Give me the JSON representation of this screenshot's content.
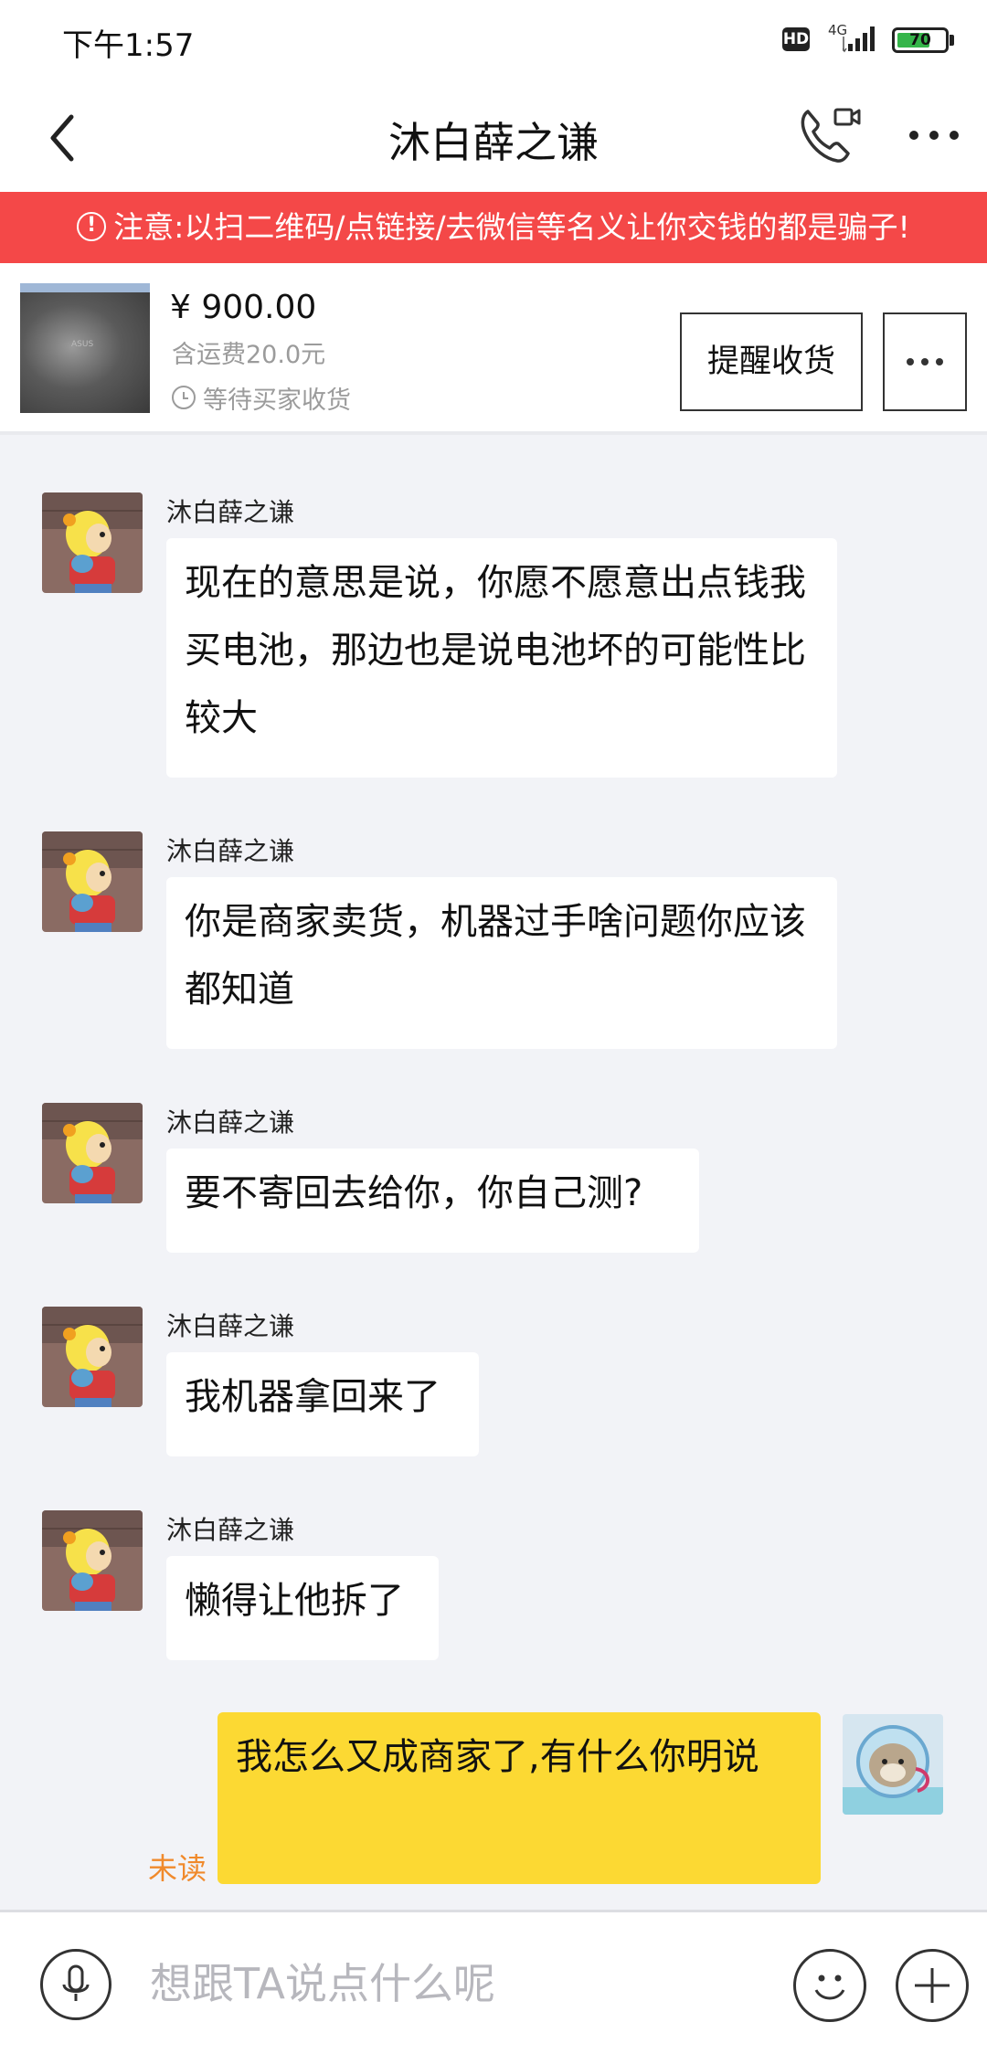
{
  "status_bar": {
    "time": "下午1:57",
    "hd": "HD",
    "network": "4G",
    "battery": "70",
    "battery_level": 0.7
  },
  "header": {
    "title": "沐白薛之谦",
    "back_icon": "chevron-left-icon",
    "call_icon": "phone-video-icon",
    "menu_icon": "more-horizontal-icon"
  },
  "warning": {
    "text": "注意:以扫二维码/点链接/去微信等名义让你交钱的都是骗子!",
    "icon": "!"
  },
  "order": {
    "price": "¥ 900.00",
    "shipping": "含运费20.0元",
    "status": "等待买家收货",
    "remind_button": "提醒收货",
    "more_icon": "more-horizontal-icon",
    "thumb_logo": "ASUS"
  },
  "messages": [
    {
      "sender": "沐白薛之谦",
      "text": "现在的意思是说，你愿不愿意出点钱我买电池，那边也是说电池坏的可能性比较大"
    },
    {
      "sender": "沐白薛之谦",
      "text": "你是商家卖货，机器过手啥问题你应该都知道"
    },
    {
      "sender": "沐白薛之谦",
      "text": "要不寄回去给你，你自己测?"
    },
    {
      "sender": "沐白薛之谦",
      "text": "我机器拿回来了"
    },
    {
      "sender": "沐白薛之谦",
      "text": "懒得让他拆了"
    }
  ],
  "my_message": {
    "text": "我怎么又成商家了,有什么你明说",
    "read_status": "未读"
  },
  "input": {
    "placeholder": "想跟TA说点什么呢",
    "voice_icon": "microphone-icon",
    "emoji_icon": "smiley-icon",
    "plus_icon": "plus-icon"
  },
  "colors": {
    "warning_bg": "#f44848",
    "my_bubble": "#fcd933",
    "unread": "#f08a2c",
    "chat_bg": "#f2f3f7"
  }
}
